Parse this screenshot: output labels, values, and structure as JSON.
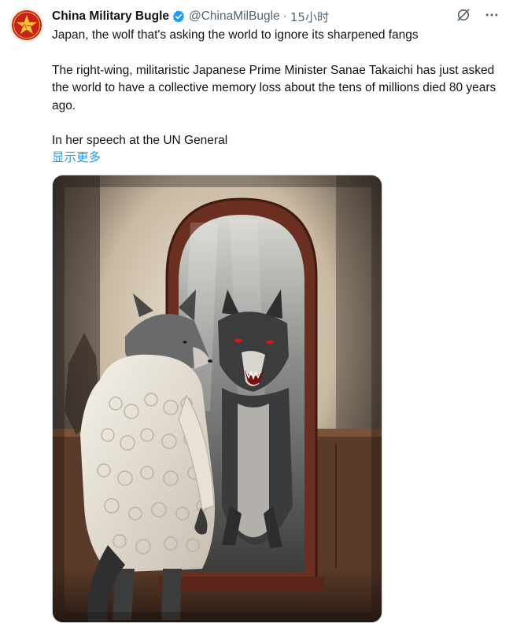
{
  "tweet": {
    "author_name": "China Military Bugle",
    "handle": "@ChinaMilBugle",
    "separator": "·",
    "time": "15小时",
    "verified": true,
    "text_line_1": "Japan, the wolf that's asking the world to ignore its sharpened fangs",
    "text_paragraph_2": "The right-wing, militaristic Japanese Prime Minister Sanae Takaichi has just asked the world to have a collective memory loss about the tens of millions died 80 years ago.",
    "text_paragraph_3": "In her speech at the UN General",
    "show_more": "显示更多"
  },
  "icons": {
    "avatar": "red-star-emblem",
    "verified": "verified-badge-icon",
    "grok": "grok-icon",
    "more": "more-options-icon"
  },
  "colors": {
    "text": "#0f1419",
    "secondary": "#536471",
    "link": "#1d9bf0",
    "avatar_red": "#c8211c"
  }
}
